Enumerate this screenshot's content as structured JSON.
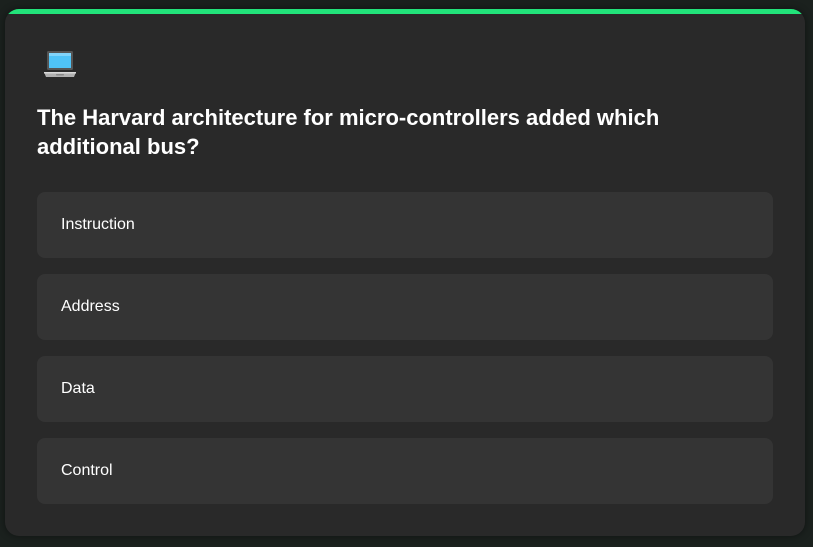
{
  "quiz": {
    "progress": 0.996,
    "icon": "laptop-icon",
    "question": "The Harvard architecture for micro-controllers added which additional bus?",
    "options": [
      {
        "label": "Instruction"
      },
      {
        "label": "Address"
      },
      {
        "label": "Data"
      },
      {
        "label": "Control"
      }
    ]
  },
  "colors": {
    "progress": "#22e37a",
    "card": "#292929",
    "option": "#343434",
    "background": "#1b211e"
  }
}
